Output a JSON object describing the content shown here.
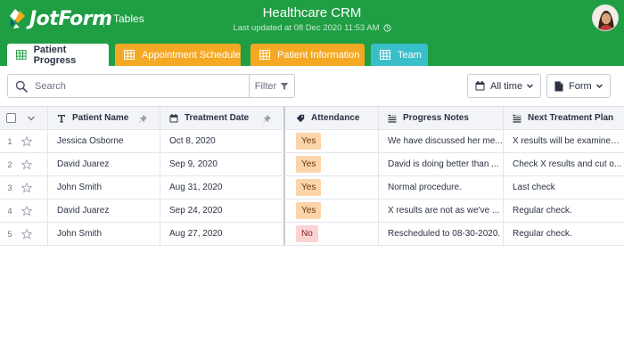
{
  "header": {
    "logo_text": "JotForm",
    "nav_link": "Tables",
    "title": "Healthcare CRM",
    "last_updated": "Last updated at 08 Dec 2020 11:53 AM"
  },
  "tabs": [
    {
      "label": "Patient Progress",
      "active": true,
      "color": "#ffffff"
    },
    {
      "label": "Appointment Schedule",
      "active": false,
      "color": "#f5a823"
    },
    {
      "label": "Patient Information",
      "active": false,
      "color": "#f5a823"
    },
    {
      "label": "Team",
      "active": false,
      "color": "#39bfc9"
    }
  ],
  "toolbar": {
    "search_placeholder": "Search",
    "filter_label": "Filter",
    "date_range_label": "All time",
    "view_label": "Form"
  },
  "columns": [
    {
      "label": "Patient Name",
      "icon": "text-type-icon"
    },
    {
      "label": "Treatment Date",
      "icon": "calendar-icon"
    },
    {
      "label": "Attendance",
      "icon": "tag-icon"
    },
    {
      "label": "Progress Notes",
      "icon": "long-text-icon"
    },
    {
      "label": "Next Treatment Plan",
      "icon": "long-text-icon"
    }
  ],
  "rows": [
    {
      "num": "1",
      "name": "Jessica Osborne",
      "date": "Oct 8, 2020",
      "attendance": "Yes",
      "notes": "We have discussed her me...",
      "plan": "X results will be examined ..."
    },
    {
      "num": "2",
      "name": "David Juarez",
      "date": "Sep 9, 2020",
      "attendance": "Yes",
      "notes": "David is doing better than ...",
      "plan": "Check X results and cut o..."
    },
    {
      "num": "3",
      "name": "John Smith",
      "date": "Aug 31, 2020",
      "attendance": "Yes",
      "notes": "Normal procedure.",
      "plan": "Last check"
    },
    {
      "num": "4",
      "name": "David Juarez",
      "date": "Sep 24, 2020",
      "attendance": "Yes",
      "notes": "X results are not as we've ...",
      "plan": "Regular check."
    },
    {
      "num": "5",
      "name": "John Smith",
      "date": "Aug 27, 2020",
      "attendance": "No",
      "notes": "Rescheduled to 08-30-2020.",
      "plan": "Regular check."
    }
  ],
  "colors": {
    "brand_green": "#1f9e44",
    "tab_orange": "#f5a823",
    "tab_teal": "#39bfc9",
    "badge_yes": "#fbd5a9",
    "badge_no": "#fbd3d3"
  }
}
